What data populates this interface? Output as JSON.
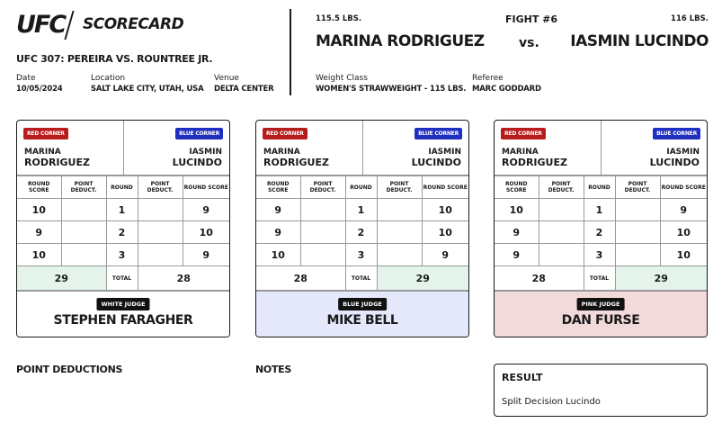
{
  "header": {
    "logo": "UFC",
    "logo_sub": "SCORECARD",
    "event": "UFC 307: PEREIRA VS. ROUNTREE JR.",
    "date_label": "Date",
    "date": "10/05/2024",
    "location_label": "Location",
    "location": "SALT LAKE CITY, UTAH, USA",
    "venue_label": "Venue",
    "venue": "DELTA CENTER"
  },
  "fight": {
    "number": "FIGHT #6",
    "red_weight": "115.5 LBS.",
    "blue_weight": "116 LBS.",
    "red_fighter": "MARINA RODRIGUEZ",
    "blue_fighter": "IASMIN LUCINDO",
    "vs": "vs.",
    "weight_class_label": "Weight Class",
    "weight_class": "WOMEN'S STRAWWEIGHT - 115 LBS.",
    "referee_label": "Referee",
    "referee": "MARC GODDARD"
  },
  "table_labels": {
    "red_corner": "RED CORNER",
    "blue_corner": "BLUE CORNER",
    "red_first": "MARINA",
    "red_last": "RODRIGUEZ",
    "blue_first": "IASMIN",
    "blue_last": "LUCINDO",
    "round_score": "ROUND SCORE",
    "point_deduct": "POINT DEDUCT.",
    "round": "ROUND",
    "total": "TOTAL"
  },
  "cards": [
    {
      "judge_badge": "WHITE JUDGE",
      "judge_name": "STEPHEN FARAGHER",
      "judge_color": "#ffffff",
      "rounds": [
        {
          "round": "1",
          "red": "10",
          "blue": "9"
        },
        {
          "round": "2",
          "red": "9",
          "blue": "10"
        },
        {
          "round": "3",
          "red": "10",
          "blue": "9"
        }
      ],
      "red_total": "29",
      "blue_total": "28",
      "winner": "red"
    },
    {
      "judge_badge": "BLUE JUDGE",
      "judge_name": "MIKE BELL",
      "judge_color": "#e5e8fb",
      "rounds": [
        {
          "round": "1",
          "red": "9",
          "blue": "10"
        },
        {
          "round": "2",
          "red": "9",
          "blue": "10"
        },
        {
          "round": "3",
          "red": "10",
          "blue": "9"
        }
      ],
      "red_total": "28",
      "blue_total": "29",
      "winner": "blue"
    },
    {
      "judge_badge": "PINK JUDGE",
      "judge_name": "DAN FURSE",
      "judge_color": "#f2dada",
      "rounds": [
        {
          "round": "1",
          "red": "10",
          "blue": "9"
        },
        {
          "round": "2",
          "red": "9",
          "blue": "10"
        },
        {
          "round": "3",
          "red": "9",
          "blue": "10"
        }
      ],
      "red_total": "28",
      "blue_total": "29",
      "winner": "blue"
    }
  ],
  "footer": {
    "point_deductions_title": "POINT DEDUCTIONS",
    "notes_title": "NOTES",
    "result_title": "RESULT",
    "result": "Split Decision Lucindo"
  },
  "colors": {
    "red_corner": "#b71c1c",
    "blue_corner": "#1f2fbf",
    "winner_highlight": "#e4f4ea"
  }
}
